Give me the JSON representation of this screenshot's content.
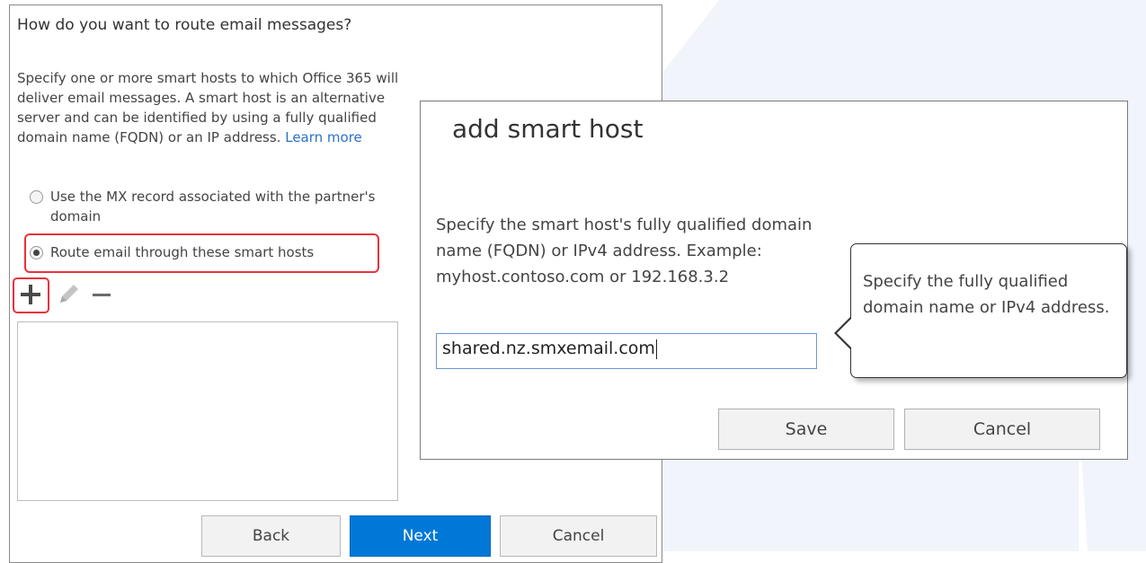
{
  "wizard": {
    "heading": "How do you want to route email messages?",
    "description": "Specify one or more smart hosts to which Office 365 will deliver email messages. A smart host is an alternative server and can be identified by using a fully qualified domain name (FQDN) or an IP address.",
    "learn_more": "Learn more",
    "options": [
      {
        "label": "Use the MX record associated with the partner's domain",
        "selected": false
      },
      {
        "label": "Route email through these smart hosts",
        "selected": true
      }
    ],
    "toolbar": {
      "add_icon": "plus-icon",
      "edit_icon": "pencil-icon",
      "remove_icon": "minus-icon"
    },
    "buttons": {
      "back": "Back",
      "next": "Next",
      "cancel": "Cancel"
    }
  },
  "dialog": {
    "title": "add smart host",
    "description": "Specify the smart host's fully qualified domain name (FQDN) or IPv4 address. Example: myhost.contoso.com or 192.168.3.2",
    "input_value": "shared.nz.smxemail.com",
    "tooltip": "Specify the fully qualified domain name or IPv4 address.",
    "buttons": {
      "save": "Save",
      "cancel": "Cancel"
    }
  },
  "colors": {
    "accent": "#0078d7",
    "highlight": "#e8323c",
    "link": "#2a72c9"
  }
}
